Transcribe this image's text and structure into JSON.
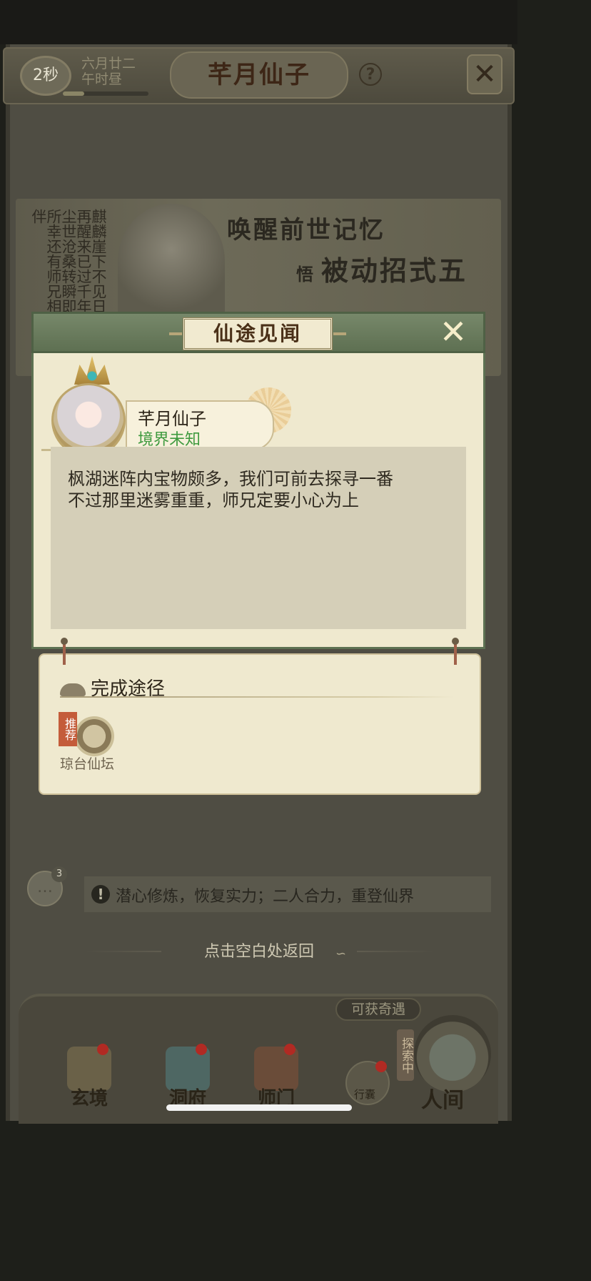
{
  "status": {
    "timer": "2秒",
    "date": "六月廿二",
    "time_of_day": "午时昼"
  },
  "header": {
    "title": "芊月仙子",
    "help": "?",
    "close": "✕"
  },
  "banner": {
    "side_text": "麒麟崖下不见日再醒来已过千年尘世沧桑转瞬即所幸还有师兄相伴",
    "line1": "唤醒前世记忆",
    "line2_prefix": "悟",
    "line2": "被动招式五"
  },
  "dialog": {
    "title": "仙途见闻",
    "npc_name": "芊月仙子",
    "npc_realm": "境界未知",
    "message": "枫湖迷阵内宝物颇多，我们可前去探寻一番\n不过那里迷雾重重，师兄定要小心为上",
    "close": "✕"
  },
  "completion": {
    "title": "完成途径",
    "route": {
      "badge": "推荐",
      "label": "琼台仙坛"
    }
  },
  "hud": {
    "chat_count": "3",
    "quest_icon": "!",
    "quest_text": "潜心修炼，恢复实力；二人合力，重登仙界",
    "back_hint": "点击空白处返回"
  },
  "nav": {
    "items": [
      {
        "label": "玄境"
      },
      {
        "label": "洞府"
      },
      {
        "label": "师门"
      }
    ],
    "bag_label": "行囊",
    "encounter": "可获奇遇",
    "explore": "探索中",
    "world": "人间"
  },
  "colors": {
    "dialog_frame": "#5d7152",
    "parchment": "#efe9cf",
    "realm_green": "#3f9a3f",
    "badge_red": "#c45c3a"
  }
}
